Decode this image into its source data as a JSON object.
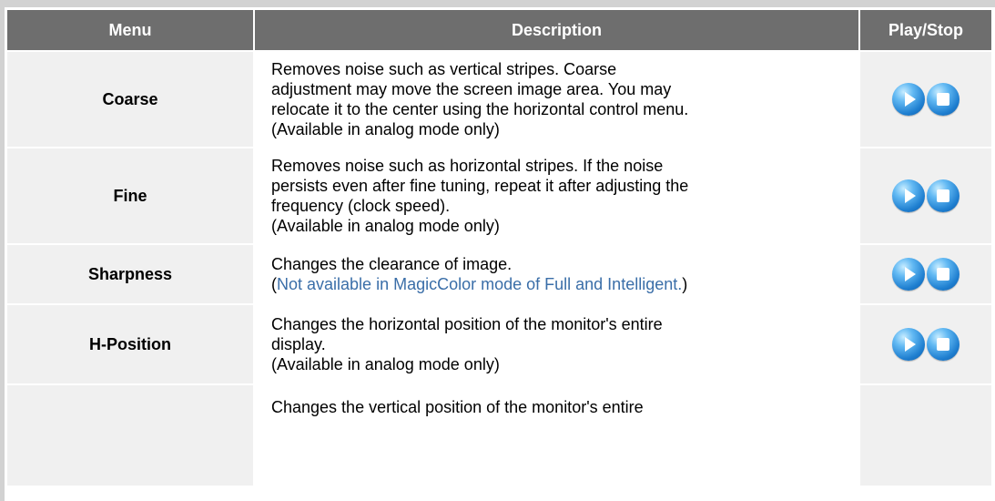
{
  "header": {
    "menu": "Menu",
    "description": "Description",
    "play_stop": "Play/Stop"
  },
  "rows": [
    {
      "menu": "Coarse",
      "lines": [
        "Removes noise such as vertical stripes. Coarse",
        "adjustment may move the screen image area. You may",
        "relocate it to the center using the horizontal control menu.",
        "(Available in analog mode only)"
      ]
    },
    {
      "menu": "Fine",
      "lines": [
        "Removes noise such as horizontal stripes. If the noise",
        "persists even after fine tuning, repeat it after adjusting the",
        "frequency (clock speed).",
        "(Available in analog mode only)"
      ]
    },
    {
      "menu": "Sharpness",
      "lines": [
        "Changes the clearance of image."
      ],
      "note_open": "(",
      "note": "Not available in MagicColor mode of Full and Intelligent.",
      "note_close": ")"
    },
    {
      "menu": "H-Position",
      "lines": [
        "Changes the horizontal position of the monitor's entire",
        "display.",
        "(Available in analog mode only)"
      ]
    },
    {
      "menu": "",
      "lines": [
        "Changes the vertical position of the monitor's entire"
      ]
    }
  ],
  "icons": {
    "play": "play-icon",
    "stop": "stop-icon"
  },
  "colors": {
    "header_bg": "#6e6e6e",
    "header_text": "#ffffff",
    "cell_gray": "#f0f0f0",
    "note_blue": "#3a6ea8",
    "button_blue": "#1f7fd0"
  }
}
